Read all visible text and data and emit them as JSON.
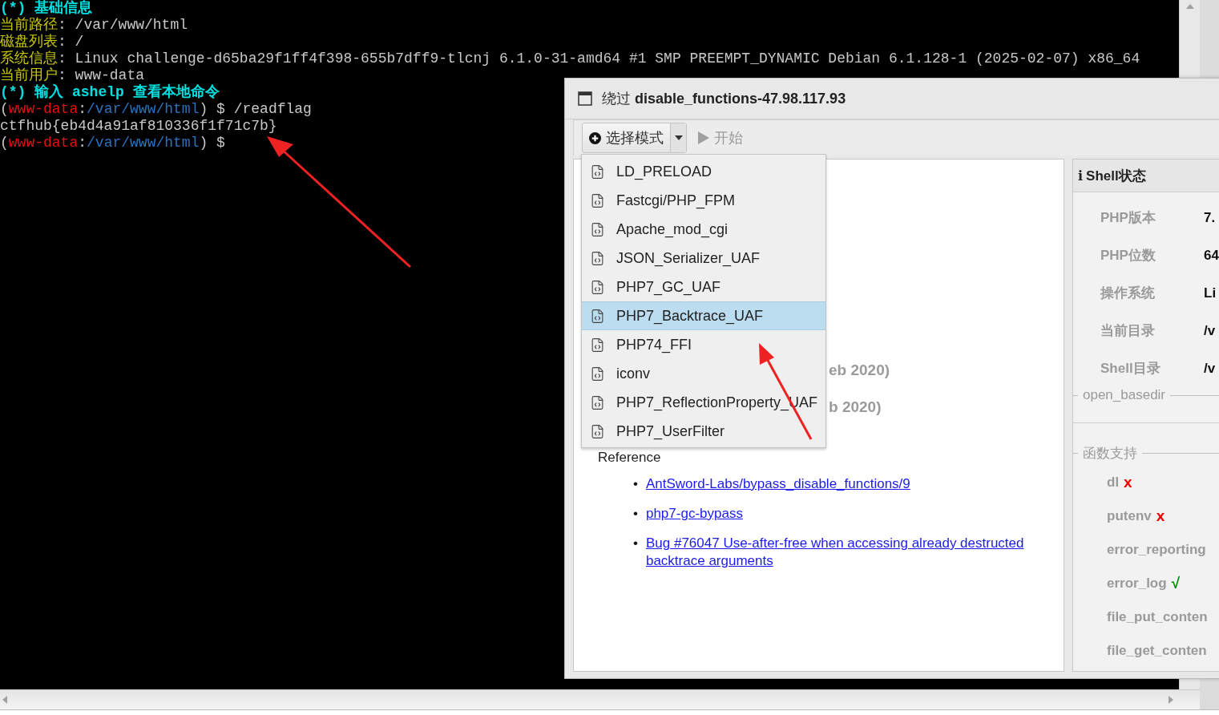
{
  "terminal": {
    "lines": [
      {
        "segments": [
          {
            "kind": "heading",
            "text": "(*) 基础信息"
          }
        ]
      },
      {
        "segments": [
          {
            "kind": "label",
            "text": "当前路径"
          },
          {
            "kind": "plain",
            "text": ": /var/www/html"
          }
        ]
      },
      {
        "segments": [
          {
            "kind": "label",
            "text": "磁盘列表"
          },
          {
            "kind": "plain",
            "text": ": /"
          }
        ]
      },
      {
        "segments": [
          {
            "kind": "label",
            "text": "系统信息"
          },
          {
            "kind": "plain",
            "text": ": Linux challenge-d65ba29f1ff4f398-655b7dff9-tlcnj 6.1.0-31-amd64 #1 SMP PREEMPT_DYNAMIC Debian 6.1.128-1 (2025-02-07) x86_64"
          }
        ]
      },
      {
        "segments": [
          {
            "kind": "label",
            "text": "当前用户"
          },
          {
            "kind": "plain",
            "text": ": www-data"
          }
        ]
      },
      {
        "segments": [
          {
            "kind": "heading",
            "text": "(*) 输入 ashelp 查看本地命令"
          }
        ]
      },
      {
        "segments": [
          {
            "kind": "plain",
            "text": "("
          },
          {
            "kind": "user",
            "text": "www-data"
          },
          {
            "kind": "plain",
            "text": ":"
          },
          {
            "kind": "path",
            "text": "/var/www/html"
          },
          {
            "kind": "plain",
            "text": ") $ /readflag"
          }
        ]
      },
      {
        "segments": [
          {
            "kind": "plain",
            "text": "ctfhub{eb4d4a91af810336f1f71c7b}"
          }
        ]
      },
      {
        "segments": [
          {
            "kind": "plain",
            "text": "("
          },
          {
            "kind": "user",
            "text": "www-data"
          },
          {
            "kind": "plain",
            "text": ":"
          },
          {
            "kind": "path",
            "text": "/var/www/html"
          },
          {
            "kind": "plain",
            "text": ") $"
          }
        ]
      }
    ]
  },
  "dialog": {
    "title": "绕过 **disable_functions-47.98.117.93**",
    "toolbar": {
      "mode_button": "选择模式",
      "start_button": {
        "label": "开始",
        "disabled": true
      }
    },
    "mode_menu": [
      {
        "label": "LD_PRELOAD",
        "selected": false
      },
      {
        "label": "Fastcgi/PHP_FPM",
        "selected": false
      },
      {
        "label": "Apache_mod_cgi",
        "selected": false
      },
      {
        "label": "JSON_Serializer_UAF",
        "selected": false
      },
      {
        "label": "PHP7_GC_UAF",
        "selected": false
      },
      {
        "label": "PHP7_Backtrace_UAF",
        "selected": true
      },
      {
        "label": "PHP74_FFI",
        "selected": false
      },
      {
        "label": "iconv",
        "selected": false
      },
      {
        "label": "PHP7_ReflectionProperty_UAF",
        "selected": false
      },
      {
        "label": "PHP7_UserFilter",
        "selected": false
      }
    ],
    "content": {
      "partial_lines": [
        "eb 2020)",
        "b 2020)"
      ],
      "reference_heading": "Reference",
      "links": [
        {
          "bullet": "•",
          "text": "AntSword-Labs/bypass_disable_functions/9"
        },
        {
          "bullet": "•",
          "text": "php7-gc-bypass"
        },
        {
          "bullet": "•",
          "text": "Bug #76047 Use-after-free when accessing already destructed backtrace arguments"
        }
      ]
    },
    "shell_status": {
      "icon": "i",
      "title": "Shell状态",
      "rows": [
        {
          "label": "PHP版本",
          "value": "7."
        },
        {
          "label": "PHP位数",
          "value": "64"
        },
        {
          "label": "操作系统",
          "value": "Li"
        },
        {
          "label": "当前目录",
          "value": "/v"
        },
        {
          "label": "Shell目录",
          "value": "/v"
        }
      ],
      "open_basedir_legend": "open_basedir",
      "functions_legend": "函数支持",
      "functions": [
        {
          "name": "dl",
          "mark": "x",
          "ok": false
        },
        {
          "name": "putenv",
          "mark": "x",
          "ok": false
        },
        {
          "name": "error_reporting"
        },
        {
          "name": "error_log",
          "mark": "√",
          "ok": true
        },
        {
          "name": "file_put_conten"
        },
        {
          "name": "file_get_conten"
        }
      ]
    }
  }
}
